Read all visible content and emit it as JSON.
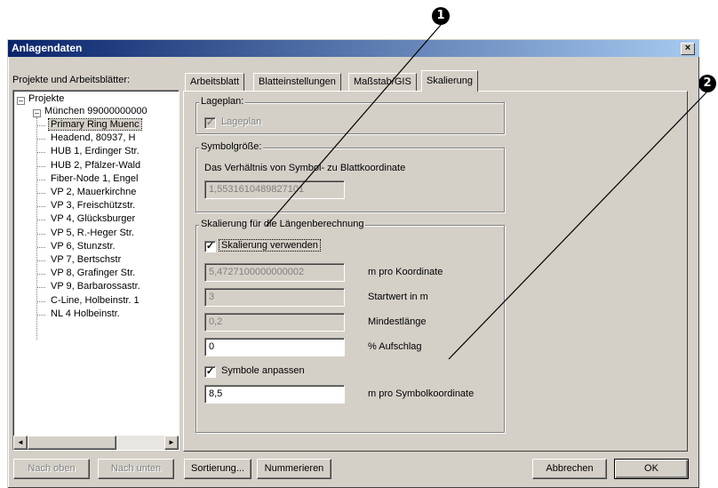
{
  "annotations": {
    "badge1": "1",
    "badge2": "2"
  },
  "window": {
    "title": "Anlagendaten",
    "close_label": "×"
  },
  "left": {
    "label": "Projekte und Arbeitsblätter:",
    "tree": {
      "root": "Projekte",
      "project": "München 99000000000",
      "items": [
        "Primary Ring Muenc",
        "Headend, 80937, H",
        "HUB 1, Erdinger Str.",
        "HUB 2, Pfälzer-Wald",
        "Fiber-Node 1, Engel",
        "VP 2, Mauerkirchne",
        "VP 3, Freischützstr.",
        "VP 4, Glücksburger",
        "VP 5, R.-Heger Str.",
        "VP 6, Stunzstr.",
        "VP 7, Bertschstr",
        "VP 8, Grafinger Str.",
        "VP 9, Barbarossastr.",
        "C-Line, Holbeinstr. 1",
        "NL 4 Holbeinstr."
      ]
    },
    "scroll_left": "◄",
    "scroll_right": "►"
  },
  "tabs": [
    "Arbeitsblatt",
    "Blatteinstellungen",
    "Maßstab/GIS",
    "Skalierung"
  ],
  "active_tab": "Skalierung",
  "lageplan": {
    "group": "Lageplan:",
    "check_label": "Lageplan",
    "checked": true
  },
  "symbolgroesse": {
    "group": "Symbolgröße:",
    "description": "Das Verhältnis von Symbol- zu Blattkoordinate",
    "value": "1,5531610489827101"
  },
  "skalierung": {
    "group": "Skalierung für die Längenberechnung",
    "use_label": "Skalierung verwenden",
    "use_checked": true,
    "m_pro_koordinate": {
      "value": "5,4727100000000002",
      "label": "m pro Koordinate"
    },
    "startwert": {
      "value": "3",
      "label": "Startwert in m"
    },
    "mindestlaenge": {
      "value": "0,2",
      "label": "Mindestlänge"
    },
    "aufschlag": {
      "value": "0",
      "label": "% Aufschlag"
    },
    "symbole_label": "Symbole anpassen",
    "symbole_checked": true,
    "m_pro_symbol": {
      "value": "8,5",
      "label": "m pro Symbolkoordinate"
    }
  },
  "buttons": {
    "nach_oben": "Nach oben",
    "nach_unten": "Nach unten",
    "sortierung": "Sortierung...",
    "nummerieren": "Nummerieren",
    "abbrechen": "Abbrechen",
    "ok": "OK"
  },
  "check_mark": "✓"
}
